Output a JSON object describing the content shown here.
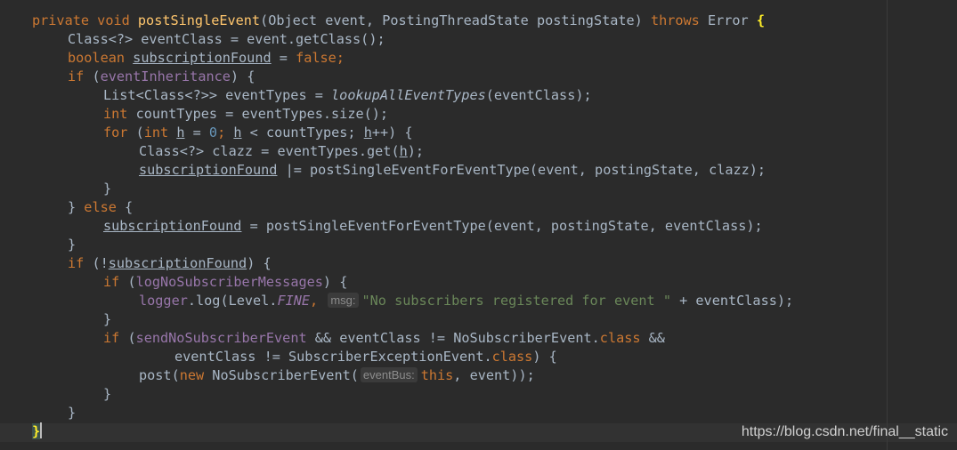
{
  "editor": {
    "colors": {
      "background": "#2b2b2b",
      "keyword": "#cc7832",
      "method_decl": "#ffc66d",
      "field": "#9876aa",
      "number": "#6897bb",
      "string": "#6a8759",
      "text": "#a9b7c6",
      "brace_highlight": "#ffef28"
    },
    "l1": {
      "private": "private",
      "void": "void",
      "name": "postSingleEvent",
      "params": "(Object event, PostingThreadState postingState) ",
      "throws": "throws",
      "error": " Error ",
      "brace": "{"
    },
    "l2": {
      "text": "Class<?> eventClass = event.getClass();"
    },
    "l3": {
      "type": "boolean",
      "var": "subscriptionFound",
      "eq": " = ",
      "val": "false",
      "semi": ";"
    },
    "l4": {
      "kw": "if",
      "open": " (",
      "field": "eventInheritance",
      "close": ") {"
    },
    "l5": {
      "decl": "List<Class<?>> eventTypes = ",
      "call": "lookupAllEventTypes",
      "args": "(eventClass);"
    },
    "l6": {
      "type": "int",
      "rest": " countTypes = eventTypes.size();"
    },
    "l7": {
      "kw": "for",
      "open": " (",
      "type": "int",
      "sp": " ",
      "h": "h",
      "eq": " = ",
      "zero": "0",
      "semi1": "; ",
      "h2": "h",
      "lt": " < countTypes; ",
      "h3": "h",
      "rest": "++) {"
    },
    "l8": {
      "pre": "Class<?> clazz = eventTypes.get(",
      "h": "h",
      "post": ");"
    },
    "l9": {
      "var": "subscriptionFound",
      "rest": " |= postSingleEventForEventType(event, postingState, clazz);"
    },
    "l10": {
      "text": "}"
    },
    "l11": {
      "close": "} ",
      "kw": "else",
      "open": " {"
    },
    "l12": {
      "var": "subscriptionFound",
      "rest": " = postSingleEventForEventType(event, postingState, eventClass);"
    },
    "l13": {
      "text": "}"
    },
    "l14": {
      "kw": "if",
      "open": " (!",
      "var": "subscriptionFound",
      "close": ") {"
    },
    "l15": {
      "kw": "if",
      "open": " (",
      "field": "logNoSubscriberMessages",
      "close": ") {"
    },
    "l16": {
      "field": "logger",
      "mid": ".log(Level.",
      "const": "FINE",
      "comma": ", ",
      "hint": "msg:",
      "str": "\"No subscribers registered for event \"",
      "rest": " + eventClass);"
    },
    "l17": {
      "text": "}"
    },
    "l18": {
      "kw": "if",
      "open": " (",
      "field": "sendNoSubscriberEvent",
      "mid": " && eventClass != NoSubscriberEvent.",
      "cls": "class",
      "and": " &&"
    },
    "l19": {
      "mid": "eventClass != SubscriberExceptionEvent.",
      "cls": "class",
      "close": ") {"
    },
    "l20": {
      "call": "post(",
      "new": "new",
      "mid": " NoSubscriberEvent(",
      "hint": "eventBus:",
      "this": "this",
      "rest": ", event));"
    },
    "l21": {
      "text": "}"
    },
    "l22": {
      "text": "}"
    },
    "l23": {
      "text": "}"
    }
  },
  "watermark": "https://blog.csdn.net/final__static"
}
